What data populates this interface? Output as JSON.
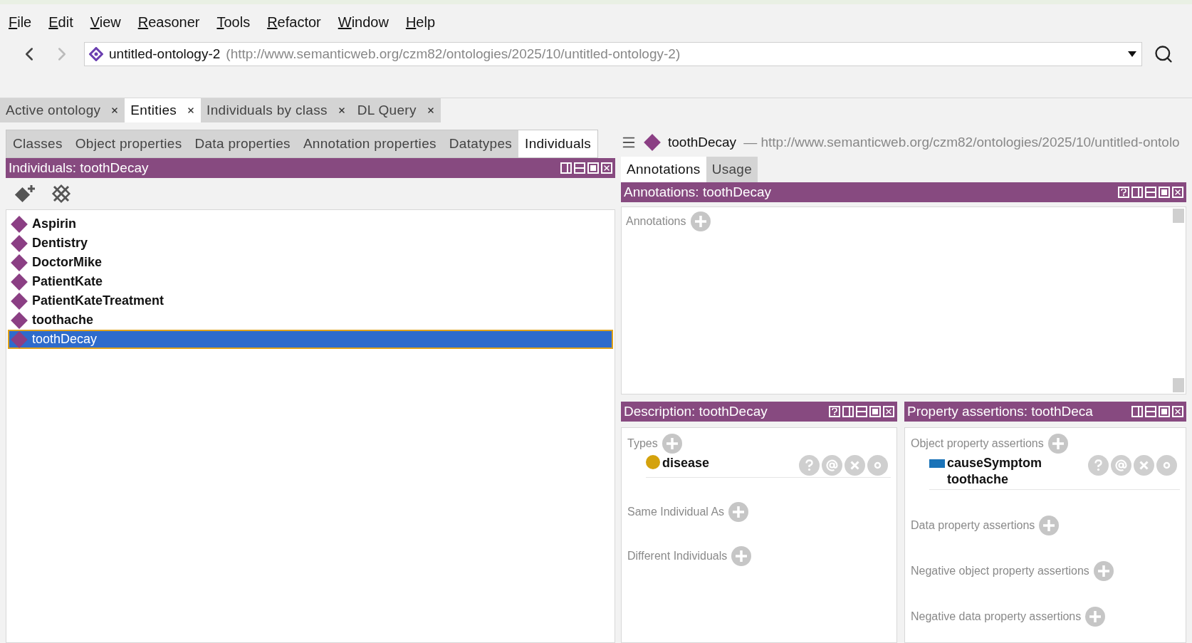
{
  "menu": [
    "File",
    "Edit",
    "View",
    "Reasoner",
    "Tools",
    "Refactor",
    "Window",
    "Help"
  ],
  "address": {
    "name": "untitled-ontology-2",
    "iri": "(http://www.semanticweb.org/czm82/ontologies/2025/10/untitled-ontology-2)"
  },
  "workspace_tabs": [
    {
      "label": "Active ontology",
      "selected": false
    },
    {
      "label": "Entities",
      "selected": true
    },
    {
      "label": "Individuals by class",
      "selected": false
    },
    {
      "label": "DL Query",
      "selected": false
    }
  ],
  "entity_tabs": [
    {
      "label": "Classes",
      "selected": false
    },
    {
      "label": "Object properties",
      "selected": false
    },
    {
      "label": "Data properties",
      "selected": false
    },
    {
      "label": "Annotation properties",
      "selected": false
    },
    {
      "label": "Datatypes",
      "selected": false
    },
    {
      "label": "Individuals",
      "selected": true
    }
  ],
  "individuals_panel": {
    "title": "Individuals: toothDecay",
    "items": [
      {
        "label": "Aspirin",
        "selected": false
      },
      {
        "label": "Dentistry",
        "selected": false
      },
      {
        "label": "DoctorMike",
        "selected": false
      },
      {
        "label": "PatientKate",
        "selected": false
      },
      {
        "label": "PatientKateTreatment",
        "selected": false
      },
      {
        "label": "toothache",
        "selected": false
      },
      {
        "label": "toothDecay",
        "selected": true
      }
    ]
  },
  "entity_header": {
    "name": "toothDecay",
    "iri": "— http://www.semanticweb.org/czm82/ontologies/2025/10/untitled-ontolo"
  },
  "detail_tabs": [
    {
      "label": "Annotations",
      "selected": true
    },
    {
      "label": "Usage",
      "selected": false
    }
  ],
  "annotations_panel": {
    "title": "Annotations: toothDecay",
    "sections": [
      {
        "label": "Annotations"
      }
    ]
  },
  "description_panel": {
    "title": "Description: toothDecay",
    "sections": [
      {
        "label": "Types",
        "entries": [
          {
            "kind": "class",
            "text": "disease"
          }
        ]
      },
      {
        "label": "Same Individual As"
      },
      {
        "label": "Different Individuals"
      }
    ]
  },
  "property_panel": {
    "title": "Property assertions: toothDeca",
    "sections": [
      {
        "label": "Object property assertions",
        "entries": [
          {
            "kind": "object_property",
            "text": "causeSymptom",
            "value": "toothache"
          }
        ]
      },
      {
        "label": "Data property assertions"
      },
      {
        "label": "Negative object property assertions"
      },
      {
        "label": "Negative data property assertions"
      }
    ]
  }
}
